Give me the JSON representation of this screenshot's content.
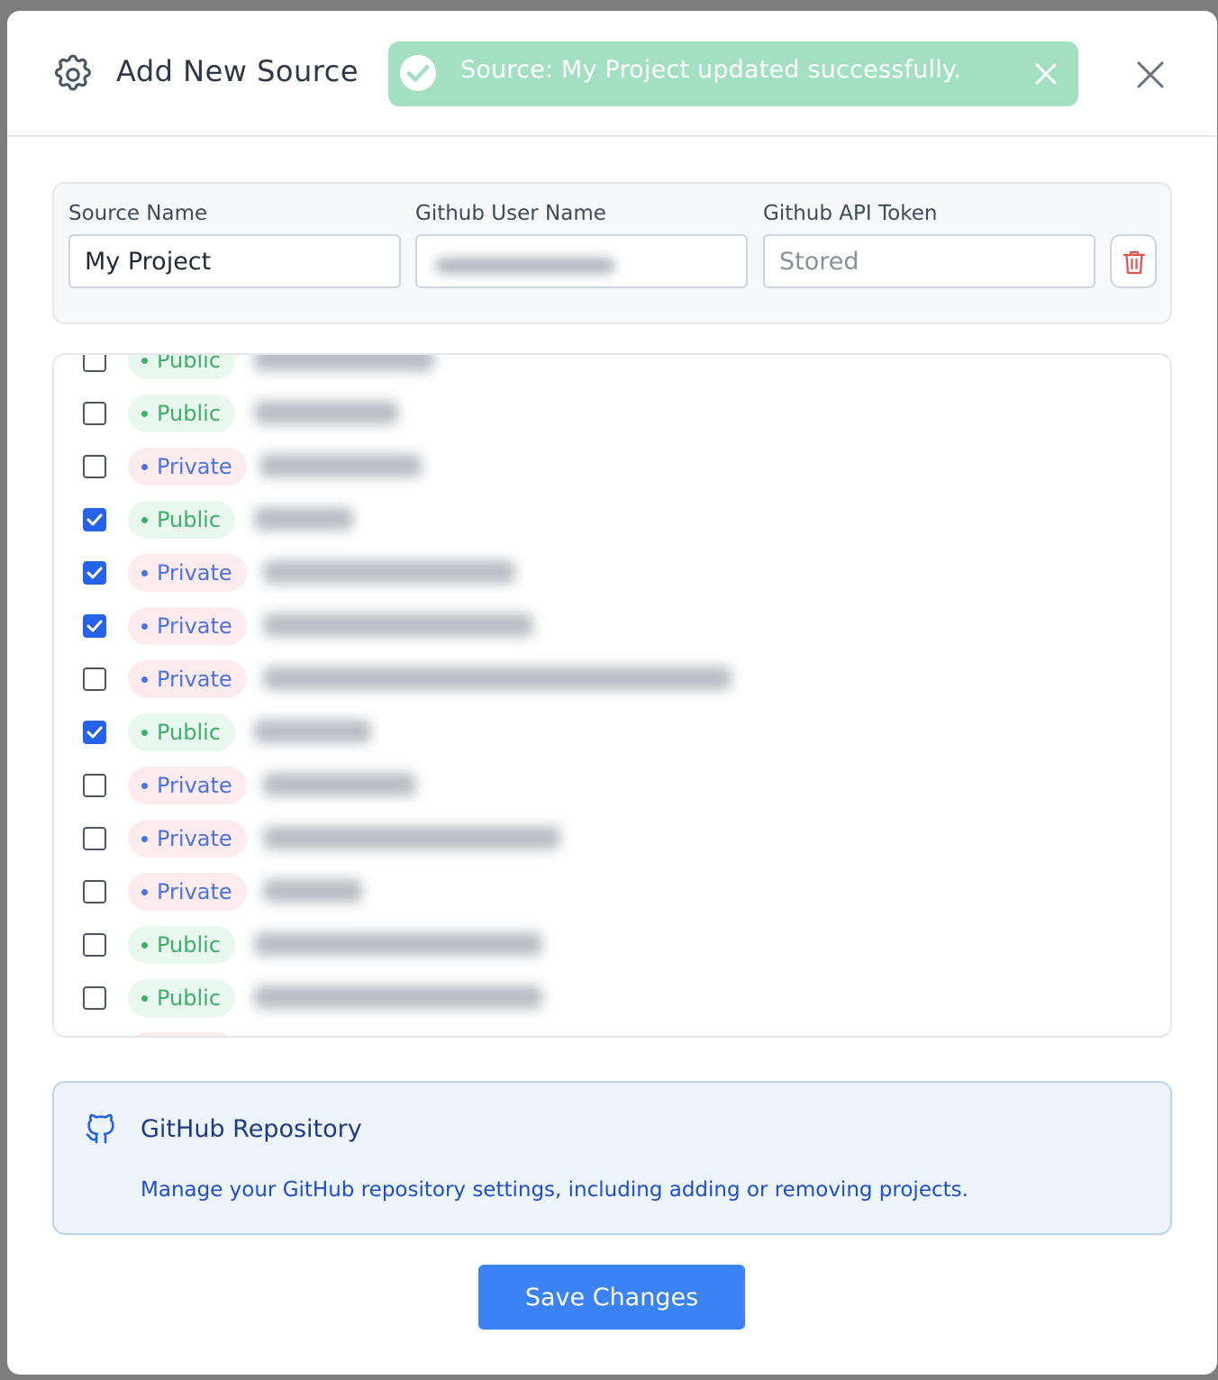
{
  "modal": {
    "title": "Add New Source",
    "toast": {
      "message": "Source: My Project updated successfully.",
      "color": "#a3dfc1"
    }
  },
  "form": {
    "source_name_label": "Source Name",
    "source_name_value": "My Project",
    "github_user_label": "Github User Name",
    "github_token_label": "Github API Token",
    "github_token_placeholder": "Stored"
  },
  "repositories": [
    {
      "visibility": "Public",
      "checked": false
    },
    {
      "visibility": "Public",
      "checked": false
    },
    {
      "visibility": "Private",
      "checked": false
    },
    {
      "visibility": "Public",
      "checked": true
    },
    {
      "visibility": "Private",
      "checked": true
    },
    {
      "visibility": "Private",
      "checked": true
    },
    {
      "visibility": "Private",
      "checked": false
    },
    {
      "visibility": "Public",
      "checked": true
    },
    {
      "visibility": "Private",
      "checked": false
    },
    {
      "visibility": "Private",
      "checked": false
    },
    {
      "visibility": "Private",
      "checked": false
    },
    {
      "visibility": "Public",
      "checked": false
    },
    {
      "visibility": "Public",
      "checked": false
    }
  ],
  "info": {
    "title": "GitHub Repository",
    "description": "Manage your GitHub repository settings, including adding or removing projects."
  },
  "actions": {
    "save_label": "Save Changes"
  },
  "colors": {
    "primary": "#3b82f6",
    "checkbox_checked": "#2563eb",
    "public_badge_text": "#3fae6a",
    "private_badge_text": "#4a74e6",
    "danger": "#e05252"
  }
}
